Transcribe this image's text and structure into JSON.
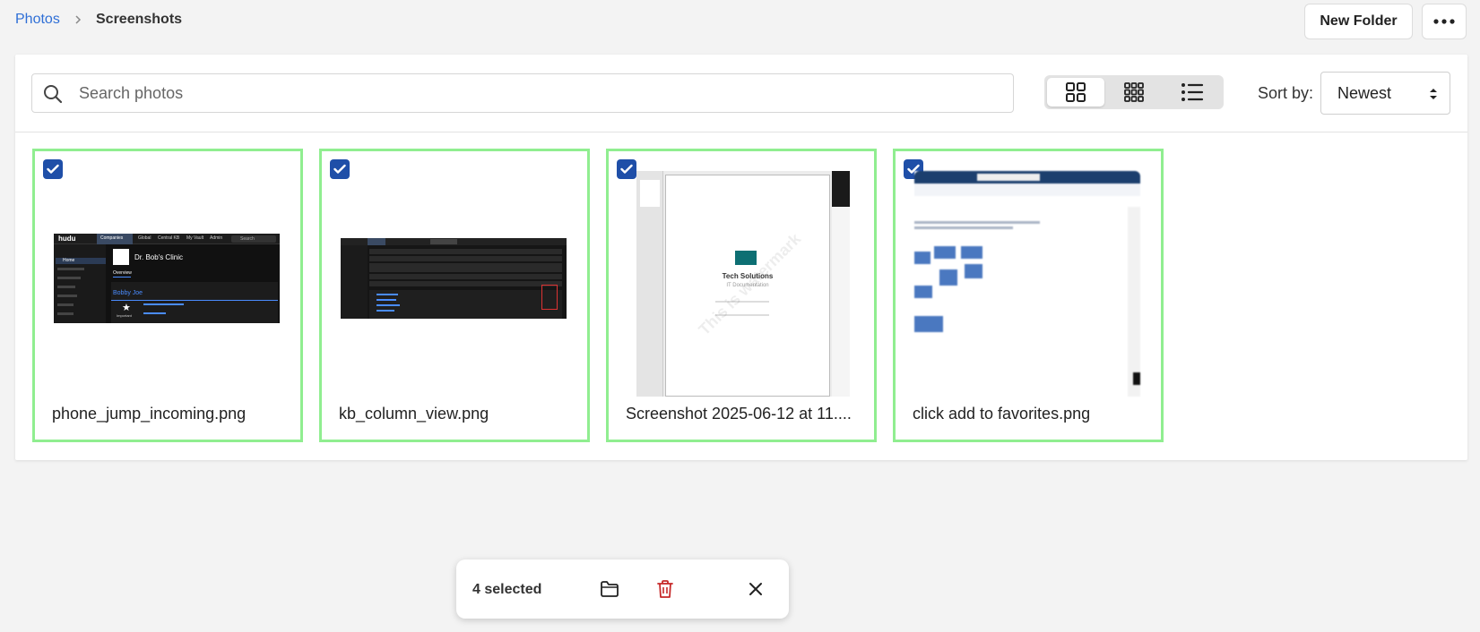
{
  "breadcrumb": {
    "root": "Photos",
    "current": "Screenshots"
  },
  "header": {
    "new_folder_label": "New Folder",
    "more_icon": "ellipsis-icon"
  },
  "toolbar": {
    "search_placeholder": "Search photos",
    "search_value": "",
    "view_modes": [
      "large-grid",
      "small-grid",
      "list"
    ],
    "active_view": "large-grid",
    "sort_label": "Sort by:",
    "sort_value": "Newest"
  },
  "photos": [
    {
      "name": "phone_jump_incoming.png",
      "selected": true
    },
    {
      "name": "kb_column_view.png",
      "selected": true
    },
    {
      "name": "Screenshot 2025-06-12 at 11....",
      "selected": true
    },
    {
      "name": "click add to favorites.png",
      "selected": true
    }
  ],
  "thumbnails": {
    "t1": {
      "clinic": "Dr. Bob's Clinic",
      "tab_overview": "Overview",
      "contact": "Bobby Joe",
      "nav_home": "Home",
      "brand": "hudu",
      "menu_companies": "Companies",
      "menu_global": "Global",
      "menu_central_kb": "Central KB",
      "menu_my_vault": "My Vault",
      "menu_admin": "Admin",
      "search": "Search",
      "important": "Important"
    },
    "t3": {
      "company": "Tech Solutions",
      "doc": "IT Documentation",
      "watermark": "This is watermark"
    }
  },
  "selection_bar": {
    "count_label": "4 selected",
    "move_icon": "folder-icon",
    "delete_icon": "trash-icon",
    "close_icon": "close-icon"
  },
  "colors": {
    "link": "#2f6fd6",
    "selected_border": "#90ee90",
    "checkbox": "#1f4fa8",
    "delete": "#c62828"
  }
}
